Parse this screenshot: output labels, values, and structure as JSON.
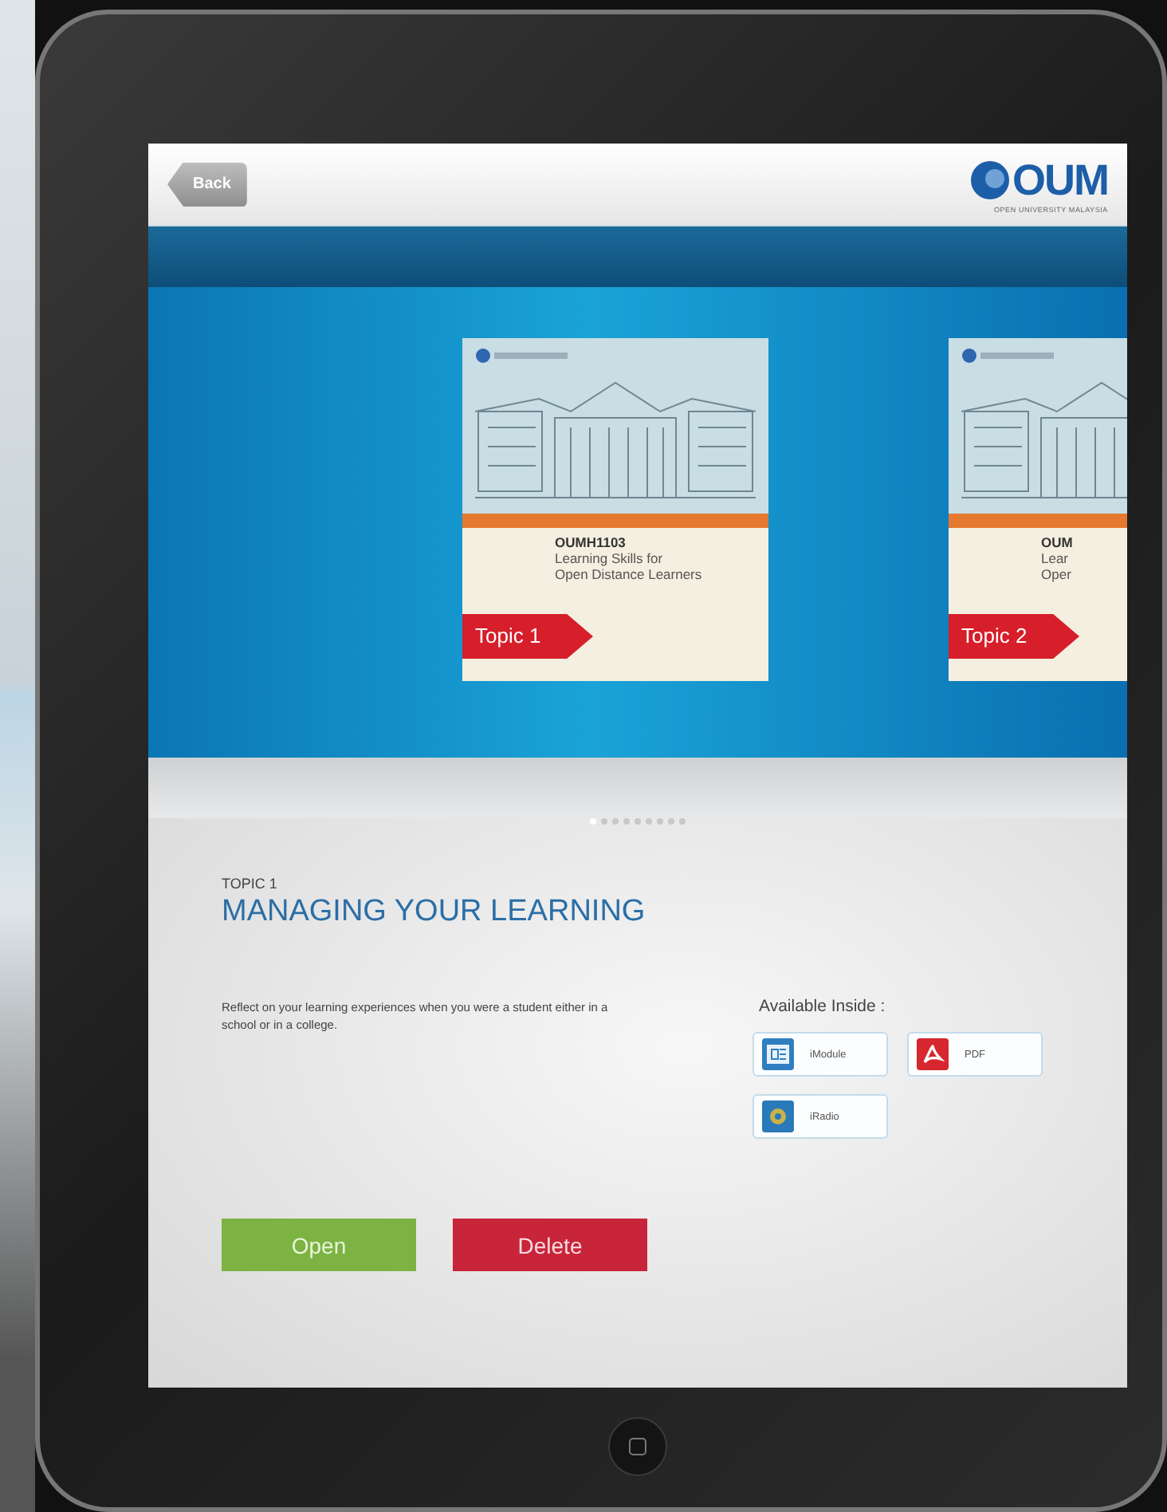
{
  "header": {
    "back_button": "Back",
    "logo": "OUM",
    "logo_tagline": "OPEN UNIVERSITY MALAYSIA"
  },
  "covers": [
    {
      "code": "OUMH1103",
      "title_lines": [
        "Learning Skills for",
        "Open Distance Learners"
      ],
      "tag": "Topic 1"
    },
    {
      "code": "OUM",
      "title_lines": [
        "Lear",
        "Oper"
      ],
      "tag": "Topic 2"
    }
  ],
  "pages": [
    {
      "selected": true
    },
    {
      "selected": false
    },
    {
      "selected": false
    },
    {
      "selected": false
    },
    {
      "selected": false
    },
    {
      "selected": false
    },
    {
      "selected": false
    },
    {
      "selected": false
    },
    {
      "selected": false
    }
  ],
  "topic": {
    "label": "TOPIC 1",
    "title": "MANAGING YOUR LEARNING",
    "description": "Reflect on your learning experiences when you were a student either in a school or in a college."
  },
  "available": {
    "heading": "Available Inside :",
    "resources": [
      {
        "kind": "module",
        "label": "iModule"
      },
      {
        "kind": "pdf",
        "label": "PDF"
      },
      {
        "kind": "radio",
        "label": "iRadio"
      }
    ]
  },
  "actions": [
    {
      "kind": "open",
      "label": "Open"
    },
    {
      "kind": "delete",
      "label": "Delete"
    }
  ]
}
